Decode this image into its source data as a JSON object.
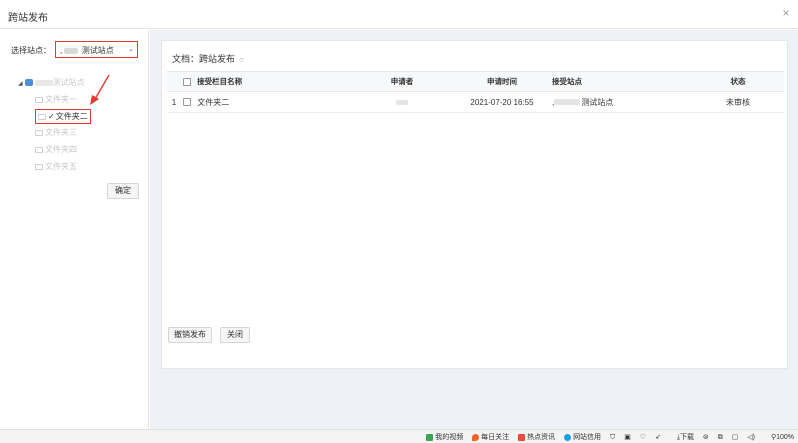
{
  "dialog": {
    "title": "跨站发布",
    "close_icon": "close-icon"
  },
  "left": {
    "site_label": "选择站点：",
    "site_select_value": "测试站点",
    "site_select_prefix": ",",
    "tree": {
      "root_label": "测试站点",
      "items": [
        {
          "label": "文件夹一",
          "checked": false
        },
        {
          "label": "文件夹二",
          "checked": true
        },
        {
          "label": "文件夹三",
          "checked": false
        },
        {
          "label": "文件夹四",
          "checked": false
        },
        {
          "label": "文件夹五",
          "checked": false
        }
      ]
    },
    "confirm_label": "确定"
  },
  "right": {
    "doc_label": "文档：",
    "doc_title": "跨站发布",
    "columns": [
      "接受栏目名称",
      "申请者",
      "申请时间",
      "接受站点",
      "状态"
    ],
    "rows": [
      {
        "index": "1",
        "column_name": "文件夹二",
        "applicant": "",
        "time": "2021-07-20 16:55",
        "site_prefix": ",",
        "site": "测试站点",
        "status": "未审核"
      }
    ],
    "revoke_label": "撤销发布",
    "close_label": "关闭"
  },
  "statusbar": {
    "items": [
      "我的视频",
      "每日关注",
      "热点资讯",
      "网站信用",
      "下载",
      "100%"
    ]
  },
  "colors": {
    "highlight_red": "#e53935",
    "panel_bg": "#eef1f5",
    "accent_blue": "#4a90d9"
  }
}
